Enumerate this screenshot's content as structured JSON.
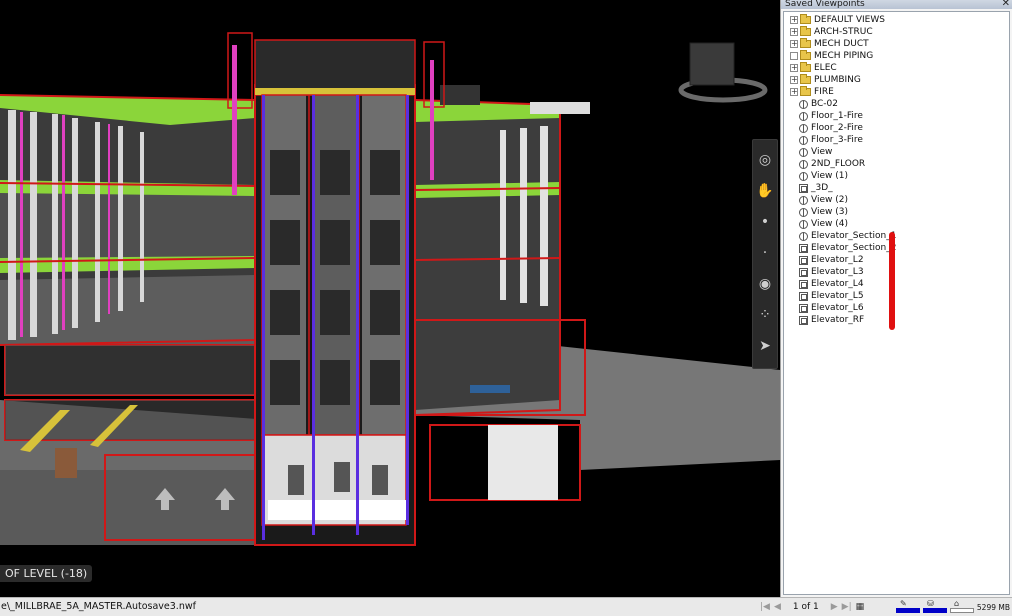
{
  "viewport": {
    "level_label": "OF LEVEL (-18)"
  },
  "panel": {
    "title": "Saved Viewpoints",
    "close_glyph": "✕",
    "folders": [
      {
        "label": "DEFAULT VIEWS",
        "expander": "+"
      },
      {
        "label": "ARCH-STRUC",
        "expander": "+"
      },
      {
        "label": "MECH DUCT",
        "expander": "+"
      },
      {
        "label": "MECH PIPING",
        "expander": ""
      },
      {
        "label": "ELEC",
        "expander": "+"
      },
      {
        "label": "PLUMBING",
        "expander": "+"
      },
      {
        "label": "FIRE",
        "expander": "+"
      }
    ],
    "viewpoints": [
      {
        "label": "BC-02",
        "icon": "camera-viewpoint-icon"
      },
      {
        "label": "Floor_1-Fire",
        "icon": "camera-viewpoint-icon"
      },
      {
        "label": "Floor_2-Fire",
        "icon": "camera-viewpoint-icon"
      },
      {
        "label": "Floor_3-Fire",
        "icon": "camera-viewpoint-icon"
      },
      {
        "label": "View",
        "icon": "camera-viewpoint-icon"
      },
      {
        "label": "2ND_FLOOR",
        "icon": "camera-viewpoint-icon"
      },
      {
        "label": "View (1)",
        "icon": "camera-viewpoint-icon"
      },
      {
        "label": "_3D_",
        "icon": "section-viewpoint-icon"
      },
      {
        "label": "View (2)",
        "icon": "camera-viewpoint-icon"
      },
      {
        "label": "View (3)",
        "icon": "camera-viewpoint-icon"
      },
      {
        "label": "View (4)",
        "icon": "camera-viewpoint-icon"
      },
      {
        "label": "Elevator_Section_1",
        "icon": "camera-viewpoint-icon"
      },
      {
        "label": "Elevator_Section_2",
        "icon": "section-viewpoint-icon"
      },
      {
        "label": "Elevator_L2",
        "icon": "section-viewpoint-icon"
      },
      {
        "label": "Elevator_L3",
        "icon": "section-viewpoint-icon"
      },
      {
        "label": "Elevator_L4",
        "icon": "section-viewpoint-icon"
      },
      {
        "label": "Elevator_L5",
        "icon": "section-viewpoint-icon"
      },
      {
        "label": "Elevator_L6",
        "icon": "section-viewpoint-icon"
      },
      {
        "label": "Elevator_RF",
        "icon": "section-viewpoint-icon"
      }
    ]
  },
  "nav_tools": [
    {
      "name": "steering-wheel-icon",
      "glyph": "◎"
    },
    {
      "name": "pan-hand-icon",
      "glyph": "✋"
    },
    {
      "name": "zoom-icon",
      "glyph": "•"
    },
    {
      "name": "orbit-icon",
      "glyph": "·"
    },
    {
      "name": "look-around-icon",
      "glyph": "◉"
    },
    {
      "name": "walk-footsteps-icon",
      "glyph": "⁘"
    },
    {
      "name": "select-cursor-icon",
      "glyph": "➤"
    }
  ],
  "status_bar": {
    "file_path": "e\\_MILLBRAE_5A_MASTER.Autosave3.nwf",
    "page_count": "1 of 1",
    "memory": "5299 MB"
  },
  "performance": {
    "pencil_fill": 1.0,
    "disk_fill": 1.0,
    "web_fill": 0.0
  },
  "colors": {
    "steel_green": "#8bd53a",
    "section_red": "#d01818",
    "pipe_magenta": "#e040c0",
    "annotation_red": "#e01010"
  }
}
